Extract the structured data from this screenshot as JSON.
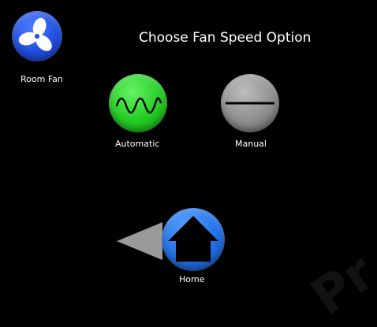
{
  "screen": {
    "title": "Choose Fan Speed Option"
  },
  "room_fan": {
    "label": "Room Fan",
    "icon": "fan-icon",
    "color": "#1f4fe0"
  },
  "options": [
    {
      "label": "Automatic",
      "icon": "sine-wave-icon",
      "color": "#22cc22"
    },
    {
      "label": "Manual",
      "icon": "minus-line-icon",
      "color": "#8e8e8e"
    }
  ],
  "navigation": {
    "back_icon": "back-arrow-icon",
    "home_label": "Home",
    "home_icon": "home-icon",
    "home_color": "#1f6fe6"
  },
  "watermark": {
    "text": "Pr"
  }
}
